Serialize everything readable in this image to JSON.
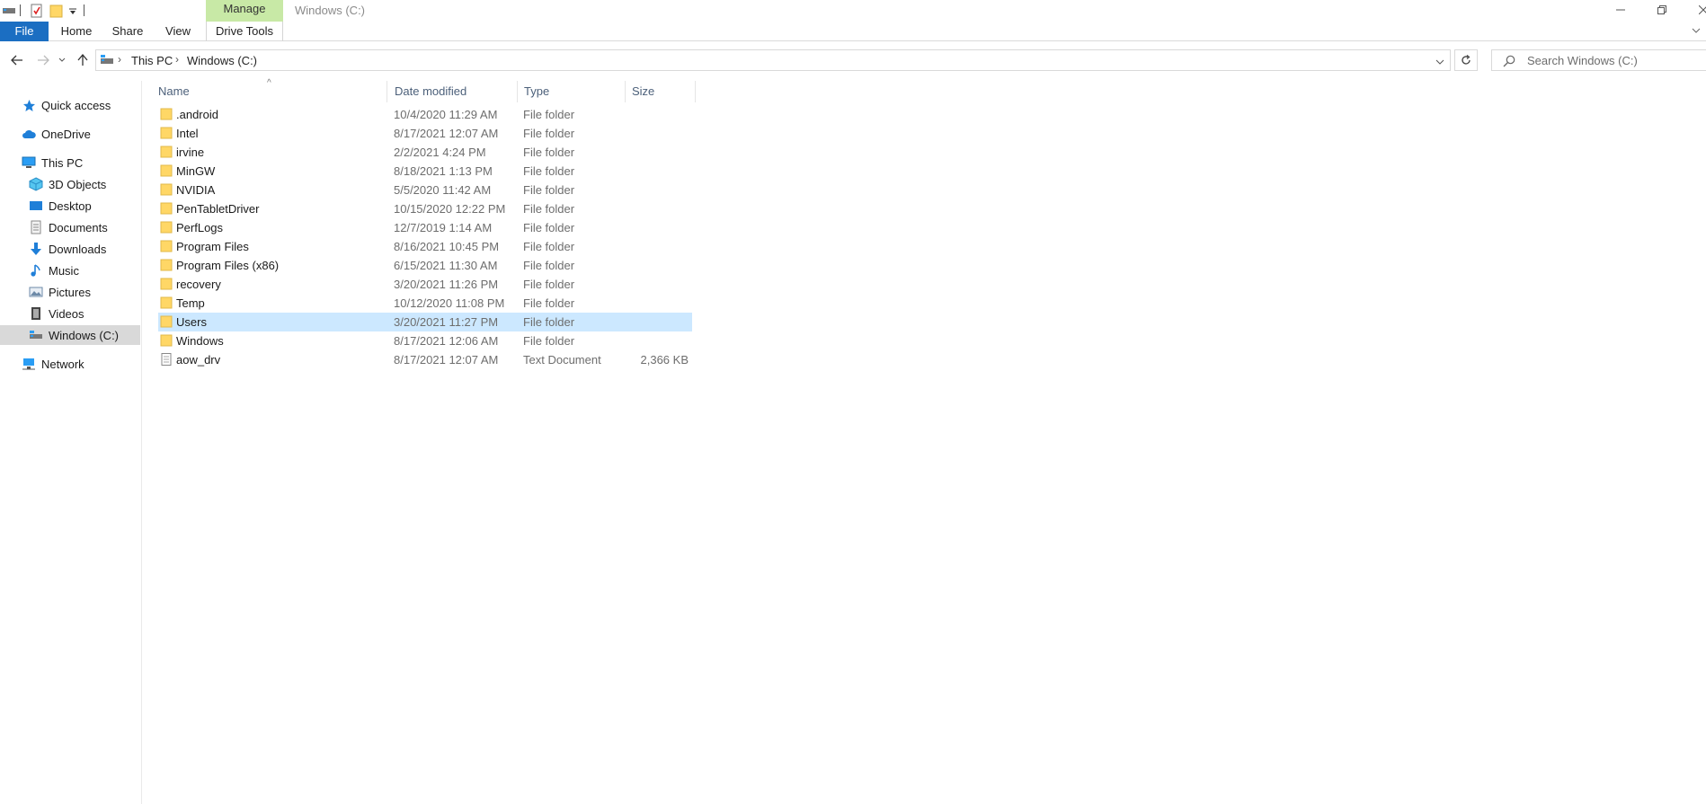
{
  "window": {
    "title": "Windows (C:)",
    "context_tab_group": "Manage"
  },
  "ribbon": {
    "tabs": [
      "File",
      "Home",
      "Share",
      "View",
      "Drive Tools"
    ]
  },
  "address": {
    "crumbs": [
      "This PC",
      "Windows (C:)"
    ],
    "search_placeholder": "Search Windows (C:)"
  },
  "nav": {
    "items": [
      {
        "label": "Quick access",
        "icon": "star-icon"
      },
      {
        "label": "OneDrive",
        "icon": "cloud-icon"
      },
      {
        "label": "This PC",
        "icon": "computer-icon"
      },
      {
        "label": "3D Objects",
        "icon": "cube-icon"
      },
      {
        "label": "Desktop",
        "icon": "desktop-icon"
      },
      {
        "label": "Documents",
        "icon": "document-icon"
      },
      {
        "label": "Downloads",
        "icon": "download-icon"
      },
      {
        "label": "Music",
        "icon": "music-icon"
      },
      {
        "label": "Pictures",
        "icon": "picture-icon"
      },
      {
        "label": "Videos",
        "icon": "video-icon"
      },
      {
        "label": "Windows (C:)",
        "icon": "drive-icon"
      },
      {
        "label": "Network",
        "icon": "network-icon"
      }
    ]
  },
  "files": {
    "columns": [
      "Name",
      "Date modified",
      "Type",
      "Size"
    ],
    "rows": [
      {
        "name": ".android",
        "date": "10/4/2020 11:29 AM",
        "type": "File folder",
        "size": ""
      },
      {
        "name": "Intel",
        "date": "8/17/2021 12:07 AM",
        "type": "File folder",
        "size": ""
      },
      {
        "name": "irvine",
        "date": "2/2/2021 4:24 PM",
        "type": "File folder",
        "size": ""
      },
      {
        "name": "MinGW",
        "date": "8/18/2021 1:13 PM",
        "type": "File folder",
        "size": ""
      },
      {
        "name": "NVIDIA",
        "date": "5/5/2020 11:42 AM",
        "type": "File folder",
        "size": ""
      },
      {
        "name": "PenTabletDriver",
        "date": "10/15/2020 12:22 PM",
        "type": "File folder",
        "size": ""
      },
      {
        "name": "PerfLogs",
        "date": "12/7/2019 1:14 AM",
        "type": "File folder",
        "size": ""
      },
      {
        "name": "Program Files",
        "date": "8/16/2021 10:45 PM",
        "type": "File folder",
        "size": ""
      },
      {
        "name": "Program Files (x86)",
        "date": "6/15/2021 11:30 AM",
        "type": "File folder",
        "size": ""
      },
      {
        "name": "recovery",
        "date": "3/20/2021 11:26 PM",
        "type": "File folder",
        "size": ""
      },
      {
        "name": "Temp",
        "date": "10/12/2020 11:08 PM",
        "type": "File folder",
        "size": ""
      },
      {
        "name": "Users",
        "date": "3/20/2021 11:27 PM",
        "type": "File folder",
        "size": ""
      },
      {
        "name": "Windows",
        "date": "8/17/2021 12:06 AM",
        "type": "File folder",
        "size": ""
      },
      {
        "name": "aow_drv",
        "date": "8/17/2021 12:07 AM",
        "type": "Text Document",
        "size": "2,366 KB"
      }
    ]
  },
  "colors": {
    "file_tab": "#1b6ec2",
    "manage_ctx": "#c8e9a6",
    "selected_row": "#cce8ff",
    "selected_nav": "#d9d9d9",
    "folder": "#ffd766"
  }
}
